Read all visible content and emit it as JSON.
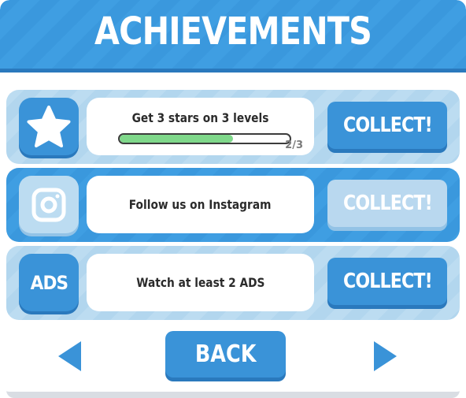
{
  "header": {
    "title": "ACHIEVEMENTS"
  },
  "achievements": [
    {
      "icon": "star-icon",
      "description": "Get 3 stars on 3 levels",
      "progress_label": "2/3",
      "progress": 0.667,
      "collect_label": "COLLECT!",
      "collect_enabled": true
    },
    {
      "icon": "instagram-icon",
      "description": "Follow us on Instagram",
      "collect_label": "COLLECT!",
      "collect_enabled": false
    },
    {
      "icon_text": "ADS",
      "description": "Watch at least 2 ADS",
      "collect_label": "COLLECT!",
      "collect_enabled": true
    }
  ],
  "footer": {
    "back_label": "BACK"
  },
  "colors": {
    "primary_blue": "#3a93d8",
    "light_blue": "#bcdcf1",
    "progress_green": "#7fd88a"
  }
}
